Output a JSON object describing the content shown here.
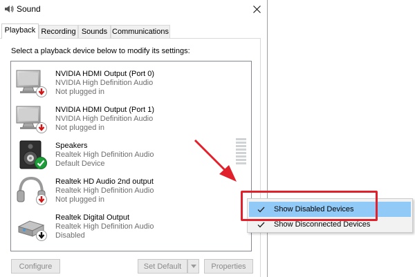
{
  "window": {
    "title": "Sound",
    "close_glyph": "✕"
  },
  "tabs": [
    {
      "label": "Playback",
      "active": true
    },
    {
      "label": "Recording",
      "active": false
    },
    {
      "label": "Sounds",
      "active": false
    },
    {
      "label": "Communications",
      "active": false
    }
  ],
  "instruction": "Select a playback device below to modify its settings:",
  "devices": [
    {
      "name": "NVIDIA HDMI Output (Port 0)",
      "driver": "NVIDIA High Definition Audio",
      "status": "Not plugged in",
      "icon": "monitor-icon",
      "badge": "red-down-arrow-badge"
    },
    {
      "name": "NVIDIA HDMI Output (Port 1)",
      "driver": "NVIDIA High Definition Audio",
      "status": "Not plugged in",
      "icon": "monitor-icon",
      "badge": "red-down-arrow-badge"
    },
    {
      "name": "Speakers",
      "driver": "Realtek High Definition Audio",
      "status": "Default Device",
      "icon": "speaker-icon",
      "badge": "green-check-badge"
    },
    {
      "name": "Realtek HD Audio 2nd output",
      "driver": "Realtek High Definition Audio",
      "status": "Not plugged in",
      "icon": "headphones-icon",
      "badge": "red-down-arrow-badge"
    },
    {
      "name": "Realtek Digital Output",
      "driver": "Realtek High Definition Audio",
      "status": "Disabled",
      "icon": "digital-output-icon",
      "badge": "black-down-arrow-badge"
    }
  ],
  "buttons": {
    "configure": "Configure",
    "set_default": "Set Default",
    "properties": "Properties"
  },
  "context_menu": {
    "items": [
      {
        "label": "Show Disabled Devices",
        "checked": true,
        "highlighted": true
      },
      {
        "label": "Show Disconnected Devices",
        "checked": true,
        "highlighted": false
      }
    ]
  },
  "colors": {
    "menu_hover": "#91c9f7",
    "annotation_red": "#e0202a",
    "disabled_text": "#8a8a8a"
  }
}
